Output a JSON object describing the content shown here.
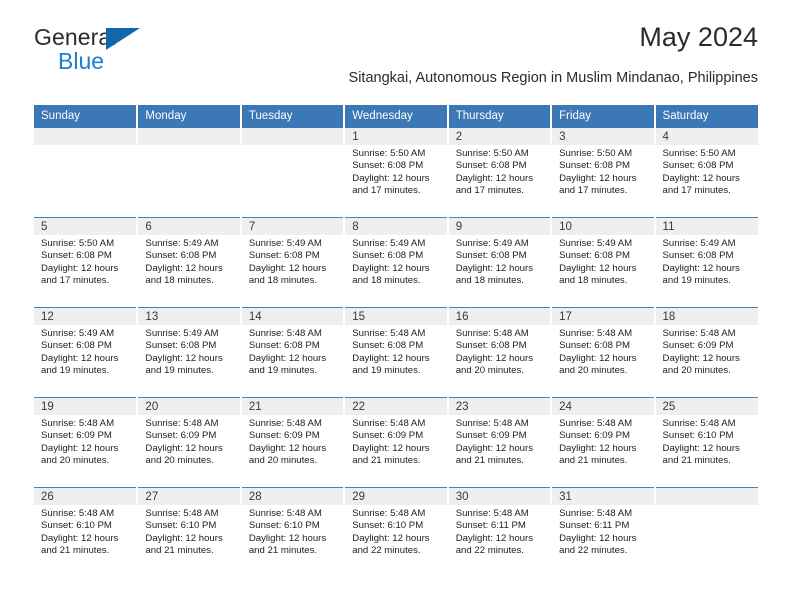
{
  "brand": {
    "name_top": "General",
    "name_bottom": "Blue",
    "accent_color": "#1a7fd4",
    "triangle_color": "#1166ac"
  },
  "header": {
    "title": "May 2024",
    "subtitle": "Sitangkai, Autonomous Region in Muslim Mindanao, Philippines",
    "header_bg_color": "#3b78b5",
    "daynum_bg_color": "#efefef"
  },
  "weekday_headers": [
    "Sunday",
    "Monday",
    "Tuesday",
    "Wednesday",
    "Thursday",
    "Friday",
    "Saturday"
  ],
  "labels": {
    "sunrise_prefix": "Sunrise:",
    "sunset_prefix": "Sunset:",
    "daylight_prefix": "Daylight:"
  },
  "weeks": [
    [
      {
        "day": "",
        "empty": true
      },
      {
        "day": "",
        "empty": true
      },
      {
        "day": "",
        "empty": true
      },
      {
        "day": "1",
        "sunrise": "Sunrise: 5:50 AM",
        "sunset": "Sunset: 6:08 PM",
        "daylight_l1": "Daylight: 12 hours",
        "daylight_l2": "and 17 minutes."
      },
      {
        "day": "2",
        "sunrise": "Sunrise: 5:50 AM",
        "sunset": "Sunset: 6:08 PM",
        "daylight_l1": "Daylight: 12 hours",
        "daylight_l2": "and 17 minutes."
      },
      {
        "day": "3",
        "sunrise": "Sunrise: 5:50 AM",
        "sunset": "Sunset: 6:08 PM",
        "daylight_l1": "Daylight: 12 hours",
        "daylight_l2": "and 17 minutes."
      },
      {
        "day": "4",
        "sunrise": "Sunrise: 5:50 AM",
        "sunset": "Sunset: 6:08 PM",
        "daylight_l1": "Daylight: 12 hours",
        "daylight_l2": "and 17 minutes."
      }
    ],
    [
      {
        "day": "5",
        "sunrise": "Sunrise: 5:50 AM",
        "sunset": "Sunset: 6:08 PM",
        "daylight_l1": "Daylight: 12 hours",
        "daylight_l2": "and 17 minutes."
      },
      {
        "day": "6",
        "sunrise": "Sunrise: 5:49 AM",
        "sunset": "Sunset: 6:08 PM",
        "daylight_l1": "Daylight: 12 hours",
        "daylight_l2": "and 18 minutes."
      },
      {
        "day": "7",
        "sunrise": "Sunrise: 5:49 AM",
        "sunset": "Sunset: 6:08 PM",
        "daylight_l1": "Daylight: 12 hours",
        "daylight_l2": "and 18 minutes."
      },
      {
        "day": "8",
        "sunrise": "Sunrise: 5:49 AM",
        "sunset": "Sunset: 6:08 PM",
        "daylight_l1": "Daylight: 12 hours",
        "daylight_l2": "and 18 minutes."
      },
      {
        "day": "9",
        "sunrise": "Sunrise: 5:49 AM",
        "sunset": "Sunset: 6:08 PM",
        "daylight_l1": "Daylight: 12 hours",
        "daylight_l2": "and 18 minutes."
      },
      {
        "day": "10",
        "sunrise": "Sunrise: 5:49 AM",
        "sunset": "Sunset: 6:08 PM",
        "daylight_l1": "Daylight: 12 hours",
        "daylight_l2": "and 18 minutes."
      },
      {
        "day": "11",
        "sunrise": "Sunrise: 5:49 AM",
        "sunset": "Sunset: 6:08 PM",
        "daylight_l1": "Daylight: 12 hours",
        "daylight_l2": "and 19 minutes."
      }
    ],
    [
      {
        "day": "12",
        "sunrise": "Sunrise: 5:49 AM",
        "sunset": "Sunset: 6:08 PM",
        "daylight_l1": "Daylight: 12 hours",
        "daylight_l2": "and 19 minutes."
      },
      {
        "day": "13",
        "sunrise": "Sunrise: 5:49 AM",
        "sunset": "Sunset: 6:08 PM",
        "daylight_l1": "Daylight: 12 hours",
        "daylight_l2": "and 19 minutes."
      },
      {
        "day": "14",
        "sunrise": "Sunrise: 5:48 AM",
        "sunset": "Sunset: 6:08 PM",
        "daylight_l1": "Daylight: 12 hours",
        "daylight_l2": "and 19 minutes."
      },
      {
        "day": "15",
        "sunrise": "Sunrise: 5:48 AM",
        "sunset": "Sunset: 6:08 PM",
        "daylight_l1": "Daylight: 12 hours",
        "daylight_l2": "and 19 minutes."
      },
      {
        "day": "16",
        "sunrise": "Sunrise: 5:48 AM",
        "sunset": "Sunset: 6:08 PM",
        "daylight_l1": "Daylight: 12 hours",
        "daylight_l2": "and 20 minutes."
      },
      {
        "day": "17",
        "sunrise": "Sunrise: 5:48 AM",
        "sunset": "Sunset: 6:08 PM",
        "daylight_l1": "Daylight: 12 hours",
        "daylight_l2": "and 20 minutes."
      },
      {
        "day": "18",
        "sunrise": "Sunrise: 5:48 AM",
        "sunset": "Sunset: 6:09 PM",
        "daylight_l1": "Daylight: 12 hours",
        "daylight_l2": "and 20 minutes."
      }
    ],
    [
      {
        "day": "19",
        "sunrise": "Sunrise: 5:48 AM",
        "sunset": "Sunset: 6:09 PM",
        "daylight_l1": "Daylight: 12 hours",
        "daylight_l2": "and 20 minutes."
      },
      {
        "day": "20",
        "sunrise": "Sunrise: 5:48 AM",
        "sunset": "Sunset: 6:09 PM",
        "daylight_l1": "Daylight: 12 hours",
        "daylight_l2": "and 20 minutes."
      },
      {
        "day": "21",
        "sunrise": "Sunrise: 5:48 AM",
        "sunset": "Sunset: 6:09 PM",
        "daylight_l1": "Daylight: 12 hours",
        "daylight_l2": "and 20 minutes."
      },
      {
        "day": "22",
        "sunrise": "Sunrise: 5:48 AM",
        "sunset": "Sunset: 6:09 PM",
        "daylight_l1": "Daylight: 12 hours",
        "daylight_l2": "and 21 minutes."
      },
      {
        "day": "23",
        "sunrise": "Sunrise: 5:48 AM",
        "sunset": "Sunset: 6:09 PM",
        "daylight_l1": "Daylight: 12 hours",
        "daylight_l2": "and 21 minutes."
      },
      {
        "day": "24",
        "sunrise": "Sunrise: 5:48 AM",
        "sunset": "Sunset: 6:09 PM",
        "daylight_l1": "Daylight: 12 hours",
        "daylight_l2": "and 21 minutes."
      },
      {
        "day": "25",
        "sunrise": "Sunrise: 5:48 AM",
        "sunset": "Sunset: 6:10 PM",
        "daylight_l1": "Daylight: 12 hours",
        "daylight_l2": "and 21 minutes."
      }
    ],
    [
      {
        "day": "26",
        "sunrise": "Sunrise: 5:48 AM",
        "sunset": "Sunset: 6:10 PM",
        "daylight_l1": "Daylight: 12 hours",
        "daylight_l2": "and 21 minutes."
      },
      {
        "day": "27",
        "sunrise": "Sunrise: 5:48 AM",
        "sunset": "Sunset: 6:10 PM",
        "daylight_l1": "Daylight: 12 hours",
        "daylight_l2": "and 21 minutes."
      },
      {
        "day": "28",
        "sunrise": "Sunrise: 5:48 AM",
        "sunset": "Sunset: 6:10 PM",
        "daylight_l1": "Daylight: 12 hours",
        "daylight_l2": "and 21 minutes."
      },
      {
        "day": "29",
        "sunrise": "Sunrise: 5:48 AM",
        "sunset": "Sunset: 6:10 PM",
        "daylight_l1": "Daylight: 12 hours",
        "daylight_l2": "and 22 minutes."
      },
      {
        "day": "30",
        "sunrise": "Sunrise: 5:48 AM",
        "sunset": "Sunset: 6:11 PM",
        "daylight_l1": "Daylight: 12 hours",
        "daylight_l2": "and 22 minutes."
      },
      {
        "day": "31",
        "sunrise": "Sunrise: 5:48 AM",
        "sunset": "Sunset: 6:11 PM",
        "daylight_l1": "Daylight: 12 hours",
        "daylight_l2": "and 22 minutes."
      },
      {
        "day": "",
        "empty": true
      }
    ]
  ]
}
